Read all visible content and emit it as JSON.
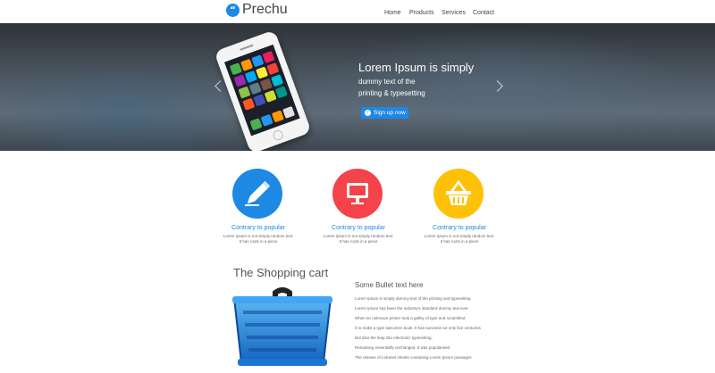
{
  "header": {
    "logo_icon": "quote-icon",
    "logo_text": "Prechu",
    "nav": [
      "Home",
      "Products",
      "Services",
      "Contact"
    ]
  },
  "hero": {
    "title": "Lorem Ipsum is simply",
    "subtitle_line1": "dummy text of the",
    "subtitle_line2": "printing & typesetting",
    "cta_label": "Sign up now",
    "cta_icon": "check-circle-icon",
    "left_arrow_icon": "chevron-left-icon",
    "right_arrow_icon": "chevron-right-icon"
  },
  "features": [
    {
      "icon": "pencil-icon",
      "color": "#1e88e5",
      "title": "Contrary to popular",
      "line1": "Lorem Ipsum is not simply random text.",
      "line2": "It has roots in a piece"
    },
    {
      "icon": "monitor-icon",
      "color": "#f4434b",
      "title": "Contrary to popular",
      "line1": "Lorem Ipsum is not simply random text.",
      "line2": "It has roots in a piece"
    },
    {
      "icon": "basket-icon",
      "color": "#ffc107",
      "title": "Contrary to popular",
      "line1": "Lorem Ipsum is not simply random text.",
      "line2": "It has roots in a piece"
    }
  ],
  "cart": {
    "title": "The Shopping cart",
    "image_icon": "shopping-basket-icon",
    "bullets_heading": "Some Bullet text here",
    "bullets": [
      "Lorem Ipsum is simply dummy text of the printing and typesetting",
      "Lorem Ipsum has been the industry's standard dummy text ever",
      "When an unknown printer took a galley of type and scrambled",
      "it to make a type specimen book. It has survived not only five centuries",
      "But also the leap into electronic typesetting,",
      "Remaining essentially unchanged. It was popularised",
      "The release of Letraset sheets containing Lorem Ipsum passages"
    ]
  },
  "colors": {
    "accent": "#1e88e5",
    "red": "#f4434b",
    "yellow": "#ffc107"
  }
}
